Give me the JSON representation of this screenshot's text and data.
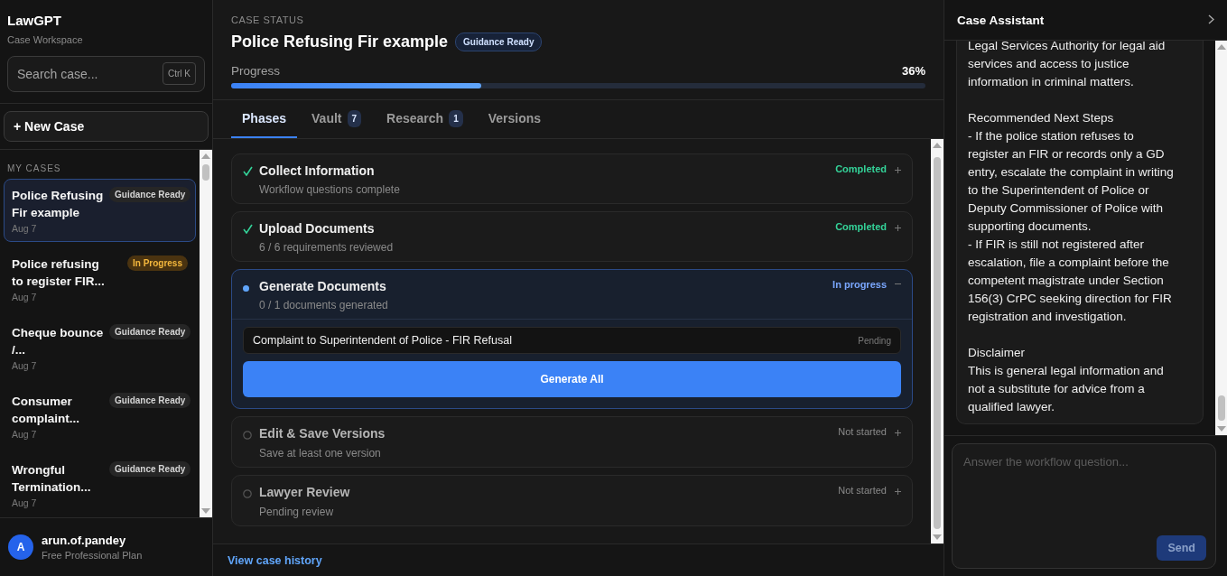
{
  "sidebar": {
    "brand": "LawGPT",
    "subtitle": "Case Workspace",
    "search": {
      "placeholder": "Search case...",
      "shortcut": "Ctrl K"
    },
    "new_case": "+ New Case",
    "section": "MY CASES",
    "cases": [
      {
        "title": "Police Refusing Fir example",
        "badge": "Guidance Ready",
        "kind": "ready",
        "date": "Aug 7",
        "selected": true
      },
      {
        "title": "Police refusing to register FIR...",
        "badge": "In Progress",
        "kind": "progress",
        "date": "Aug 7",
        "selected": false
      },
      {
        "title": "Cheque bounce /...",
        "badge": "Guidance Ready",
        "kind": "ready",
        "date": "Aug 7",
        "selected": false
      },
      {
        "title": "Consumer complaint...",
        "badge": "Guidance Ready",
        "kind": "ready",
        "date": "Aug 7",
        "selected": false
      },
      {
        "title": "Wrongful Termination...",
        "badge": "Guidance Ready",
        "kind": "ready",
        "date": "Aug 7",
        "selected": false
      }
    ],
    "user": {
      "avatar": "A",
      "name": "arun.of.pandey",
      "plan": "Free Professional Plan"
    }
  },
  "case": {
    "eyebrow": "CASE STATUS",
    "title": "Police Refusing Fir example",
    "badge": "Guidance Ready",
    "progress": {
      "label": "Progress",
      "reading": "36%",
      "level": 0.36
    }
  },
  "tabs": [
    {
      "label": "Phases",
      "selected": true
    },
    {
      "label": "Vault",
      "count": "7",
      "selected": false
    },
    {
      "label": "Research",
      "count": "1",
      "selected": false
    },
    {
      "label": "Versions",
      "selected": false
    }
  ],
  "phases": [
    {
      "title": "Collect Information",
      "detail": "Workflow questions complete",
      "status": "Completed",
      "kind": "completed",
      "expanded": false
    },
    {
      "title": "Upload Documents",
      "detail": "6 / 6 requirements reviewed",
      "status": "Completed",
      "kind": "completed",
      "expanded": false
    },
    {
      "title": "Generate Documents",
      "detail": "0 / 1 documents generated",
      "status": "In progress",
      "kind": "in_progress",
      "expanded": true,
      "documents": [
        {
          "name": "Complaint to Superintendent of Police - FIR Refusal",
          "status": "Pending"
        }
      ],
      "action": "Generate All"
    },
    {
      "title": "Edit & Save Versions",
      "detail": "Save at least one version",
      "status": "Not started",
      "kind": "not_started",
      "expanded": false
    },
    {
      "title": "Lawyer Review",
      "detail": "Pending review",
      "status": "Not started",
      "kind": "not_started",
      "expanded": false
    }
  ],
  "footer_link": "View case history",
  "assistant": {
    "title": "Case Assistant",
    "message": [
      "Legal Services Authority for legal aid services and access to justice information in criminal matters.",
      "Recommended Next Steps\n- If the police station refuses to register an FIR or records only a GD entry, escalate the complaint in writing to the Superintendent of Police or Deputy Commissioner of Police with supporting documents.\n- If FIR is still not registered after escalation, file a complaint before the competent magistrate under Section 156(3) CrPC seeking direction for FIR registration and investigation.",
      "Disclaimer\nThis is general legal information and not a substitute for advice from a qualified lawyer."
    ],
    "input": {
      "placeholder": "Answer the workflow question..."
    },
    "send": {
      "label": "Send",
      "disabled": true
    }
  }
}
